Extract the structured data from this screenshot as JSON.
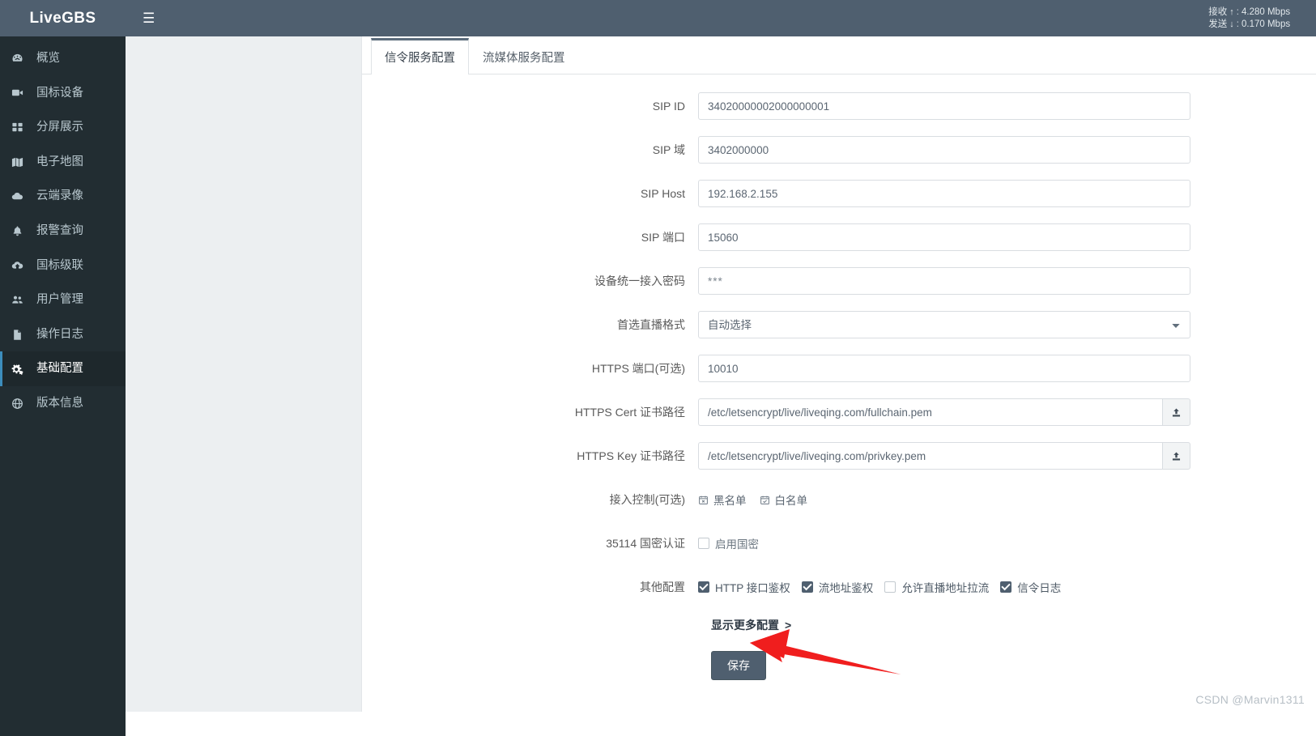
{
  "brand": {
    "title": "LiveGBS"
  },
  "topbar": {
    "menu_icon": "hamburger-icon",
    "net": {
      "rx_label": "接收",
      "rx_arrow": "↑",
      "rx_sep": ":",
      "rx_value": "4.280 Mbps",
      "tx_label": "发送",
      "tx_arrow": "↓",
      "tx_sep": ":",
      "tx_value": "0.170 Mbps"
    }
  },
  "sidebar": {
    "items": [
      {
        "label": "概览",
        "icon": "dashboard-icon",
        "active": false
      },
      {
        "label": "国标设备",
        "icon": "video-camera-icon",
        "active": false
      },
      {
        "label": "分屏展示",
        "icon": "grid-icon",
        "active": false
      },
      {
        "label": "电子地图",
        "icon": "map-icon",
        "active": false
      },
      {
        "label": "云端录像",
        "icon": "cloud-icon",
        "active": false
      },
      {
        "label": "报警查询",
        "icon": "bell-icon",
        "active": false
      },
      {
        "label": "国标级联",
        "icon": "cloud-upload-icon",
        "active": false
      },
      {
        "label": "用户管理",
        "icon": "users-icon",
        "active": false
      },
      {
        "label": "操作日志",
        "icon": "file-icon",
        "active": false
      },
      {
        "label": "基础配置",
        "icon": "gears-icon",
        "active": true
      },
      {
        "label": "版本信息",
        "icon": "globe-icon",
        "active": false
      }
    ]
  },
  "tabs": [
    {
      "label": "信令服务配置",
      "active": true
    },
    {
      "label": "流媒体服务配置",
      "active": false
    }
  ],
  "form": {
    "fields": [
      {
        "label": "SIP ID",
        "value": "34020000002000000001",
        "type": "text"
      },
      {
        "label": "SIP 域",
        "value": "3402000000",
        "type": "text"
      },
      {
        "label": "SIP Host",
        "value": "192.168.2.155",
        "type": "text"
      },
      {
        "label": "SIP 端口",
        "value": "15060",
        "type": "text"
      },
      {
        "label": "设备统一接入密码",
        "value": "***",
        "type": "password"
      },
      {
        "label": "首选直播格式",
        "value": "自动选择",
        "type": "select",
        "options": [
          "自动选择"
        ]
      },
      {
        "label": "HTTPS 端口(可选)",
        "value": "10010",
        "type": "text"
      },
      {
        "label": "HTTPS Cert 证书路径",
        "value": "/etc/letsencrypt/live/liveqing.com/fullchain.pem",
        "type": "upload",
        "addon_icon": "upload-icon"
      },
      {
        "label": "HTTPS Key 证书路径",
        "value": "/etc/letsencrypt/live/liveqing.com/privkey.pem",
        "type": "upload",
        "addon_icon": "upload-icon"
      }
    ],
    "access_control": {
      "label": "接入控制(可选)",
      "buttons": [
        {
          "label": "黑名单",
          "icon": "blacklist-icon"
        },
        {
          "label": "白名单",
          "icon": "whitelist-icon"
        }
      ]
    },
    "gm_auth": {
      "label": "35114 国密认证",
      "checkbox": {
        "label": "启用国密",
        "checked": false
      }
    },
    "other_config": {
      "label": "其他配置",
      "checkboxes": [
        {
          "label": "HTTP 接口鉴权",
          "checked": true
        },
        {
          "label": "流地址鉴权",
          "checked": true
        },
        {
          "label": "允许直播地址拉流",
          "checked": false
        },
        {
          "label": "信令日志",
          "checked": true
        }
      ]
    },
    "more_config": {
      "label": "显示更多配置",
      "chevron": ">"
    },
    "save_button": {
      "label": "保存"
    }
  },
  "watermark": {
    "text": "CSDN @Marvin1311"
  },
  "colors": {
    "sidebar_bg": "#222d32",
    "header_bg": "#4f5f6f",
    "accent": "#3c8dbc",
    "annotation_red": "#f01e1e",
    "button_bg": "#4f5f6f"
  }
}
